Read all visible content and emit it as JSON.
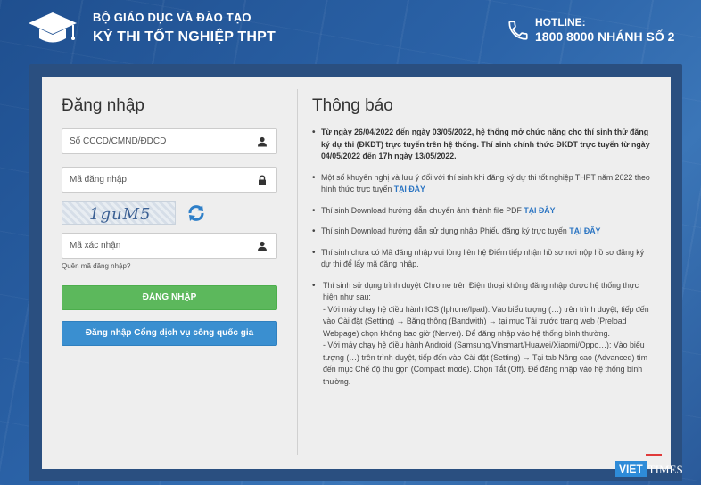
{
  "header": {
    "org_line1": "BỘ GIÁO DỤC VÀ ĐÀO TẠO",
    "org_line2": "KỲ THI TỐT NGHIỆP THPT",
    "hotline_label": "HOTLINE:",
    "hotline_number": "1800 8000 NHÁNH SỐ 2",
    "logo_icon": "graduation-cap-icon",
    "phone_icon": "phone-icon"
  },
  "login": {
    "title": "Đăng nhập",
    "id_placeholder": "Số CCCD/CMND/ĐDCD",
    "code_placeholder": "Mã đăng nhập",
    "captcha_text": "1guM5",
    "verify_placeholder": "Mã xác nhận",
    "forgot_link": "Quên mã đăng nhập?",
    "login_button": "ĐĂNG NHẬP",
    "gov_login_button": "Đăng nhập Cổng dịch vụ công quốc gia"
  },
  "notices": {
    "title": "Thông báo",
    "items": [
      {
        "text": "Từ ngày 26/04/2022 đến ngày 03/05/2022, hệ thống mở chức năng cho thí sinh thử đăng ký dự thi (ĐKDT) trực tuyến trên hệ thống. Thí sinh chính thức ĐKDT trực tuyến từ ngày 04/05/2022 đến 17h ngày 13/05/2022.",
        "link": ""
      },
      {
        "text": "Một số khuyến nghị và lưu ý đối với thí sinh khi đăng ký dự thi tốt nghiệp THPT năm 2022 theo hình thức trực tuyến ",
        "link": "TẠI ĐÂY"
      },
      {
        "text": "Thí sinh Download hướng dẫn chuyển ảnh thành file PDF ",
        "link": "TẠI ĐÂY"
      },
      {
        "text": "Thí sinh Download hướng dẫn sử dụng nhập Phiếu đăng ký trực tuyến ",
        "link": "TẠI ĐÂY"
      },
      {
        "text": "Thí sinh chưa có Mã đăng nhập vui lòng liên hệ Điểm tiếp nhận hồ sơ nơi nộp hồ sơ đăng ký dự thi để lấy mã đăng nhập.",
        "link": ""
      }
    ],
    "browser_note": {
      "intro": "Thí sinh sử dụng trình duyệt Chrome trên Điện thoại không đăng nhập được hệ thống thực hiện như sau:",
      "ios": " - Với máy chạy hệ điều hành IOS (Iphone/Ipad): Vào biểu tượng (…) trên trình duyệt, tiếp đến vào Cài đặt (Setting) → Băng thông (Bandwith) → tại mục Tải trước trang web (Preload Webpage) chọn không bao giờ (Nerver). Để đăng nhập vào hệ thống bình thường.",
      "android": " - Với máy chạy hệ điều hành Android (Samsung/Vinsmart/Huawei/Xiaomi/Oppo…): Vào biểu tượng (…) trên trình duyệt, tiếp đến vào Cài đặt (Setting) → Tại tab Nâng cao (Advanced) tìm đến mục Chế độ thu gọn (Compact mode). Chọn Tắt (Off). Để đăng nhập vào hệ thống bình thường."
    }
  },
  "watermark": {
    "part1": "VIET",
    "part2": "TIMES"
  },
  "colors": {
    "primary_green": "#5cb85c",
    "primary_blue": "#3a8fd0",
    "link": "#2a74c2"
  }
}
